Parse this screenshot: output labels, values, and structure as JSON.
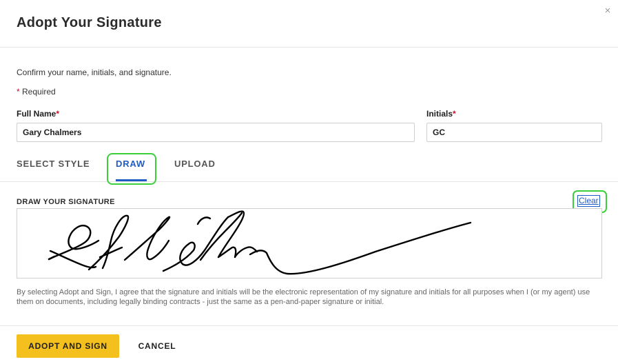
{
  "dialog": {
    "title": "Adopt Your Signature",
    "close_icon": "×"
  },
  "form": {
    "intro": "Confirm your name, initials, and signature.",
    "required_star": "*",
    "required_text": " Required",
    "full_name": {
      "label": "Full Name",
      "star": "*",
      "value": "Gary Chalmers"
    },
    "initials": {
      "label": "Initials",
      "star": "*",
      "value": "GC"
    }
  },
  "tabs": [
    {
      "label": "SELECT STYLE",
      "active": false
    },
    {
      "label": "DRAW",
      "active": true
    },
    {
      "label": "UPLOAD",
      "active": false
    }
  ],
  "draw": {
    "label": "DRAW YOUR SIGNATURE",
    "clear_label": "Clear"
  },
  "legal_text": "By selecting Adopt and Sign, I agree that the signature and initials will be the electronic representation of my signature and initials for all purposes when I (or my agent) use them on documents, including legally binding contracts - just the same as a pen-and-paper signature or initial.",
  "footer": {
    "adopt_label": "ADOPT AND SIGN",
    "cancel_label": "CANCEL"
  },
  "colors": {
    "accent_blue": "#1f5cc4",
    "adopt_yellow": "#f4c01e",
    "highlight_green": "#3ccf3c",
    "required_red": "#c8102e"
  }
}
